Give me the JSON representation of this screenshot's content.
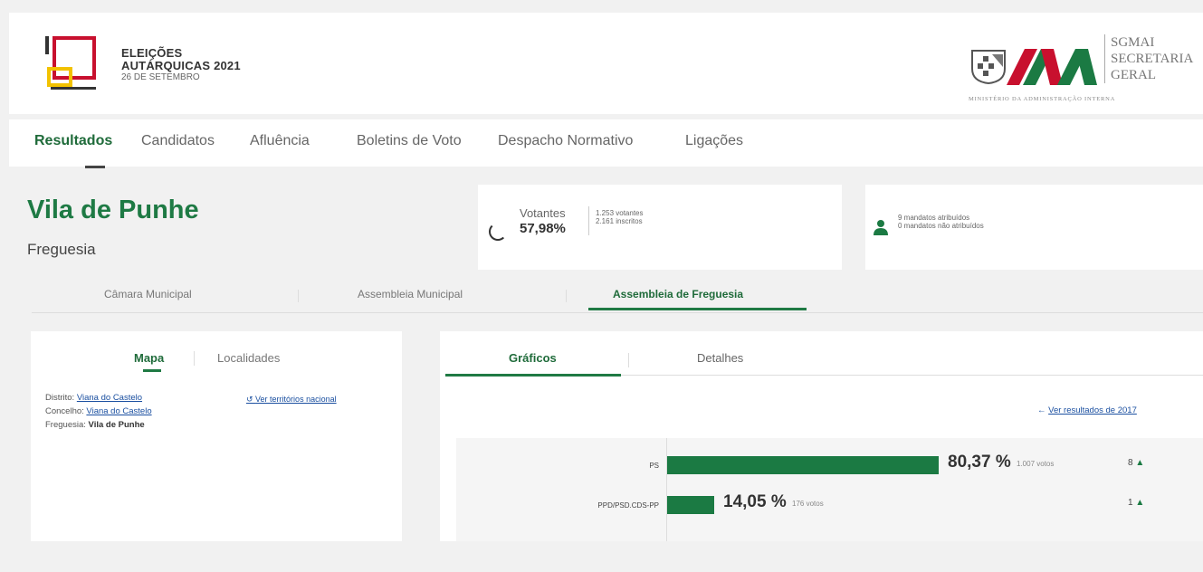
{
  "header": {
    "title_line1": "ELEIÇÕES",
    "title_line2": "AUTÁRQUICAS 2021",
    "date": "26 DE SETEMBRO",
    "org_line1": "SGMAI",
    "org_line2": "SECRETARIA",
    "org_line3": "GERAL",
    "ministry": "MINISTÉRIO DA ADMINISTRAÇÃO INTERNA"
  },
  "nav": {
    "items": [
      "Resultados",
      "Candidatos",
      "Afluência",
      "Boletins de Voto",
      "Despacho Normativo",
      "Ligações"
    ]
  },
  "place": {
    "name": "Vila de Punhe",
    "type": "Freguesia"
  },
  "votantes": {
    "label": "Votantes",
    "percent": "57,98%",
    "voters": "1.253 votantes",
    "registered": "2.161 inscritos"
  },
  "mandatos": {
    "attributed": "9 mandatos atribuídos",
    "not_attributed": "0 mandatos não atribuídos"
  },
  "tabs": [
    "Câmara Municipal",
    "Assembleia Municipal",
    "Assembleia de Freguesia"
  ],
  "left_panel": {
    "tabs": [
      "Mapa",
      "Localidades"
    ],
    "distrito_label": "Distrito:",
    "distrito_value": "Viana do Castelo",
    "concelho_label": "Concelho:",
    "concelho_value": "Viana do Castelo",
    "freguesia_label": "Freguesia:",
    "freguesia_value": "Vila de Punhe",
    "link": "Ver territórios nacional"
  },
  "right_panel": {
    "tabs": [
      "Gráficos",
      "Detalhes"
    ],
    "link": "Ver resultados de 2017",
    "results": [
      {
        "party": "PS",
        "percent": "80,37 %",
        "votes": "1.007 votos",
        "seats": "8",
        "value": 80.37
      },
      {
        "party": "PPD/PSD.CDS-PP",
        "percent": "14,05 %",
        "votes": "176 votos",
        "seats": "1",
        "value": 14.05
      }
    ]
  },
  "colors": {
    "primary": "#1e7a44",
    "link": "#1a4fa0",
    "logo_red": "#c8102e",
    "logo_yellow": "#f2c200"
  }
}
